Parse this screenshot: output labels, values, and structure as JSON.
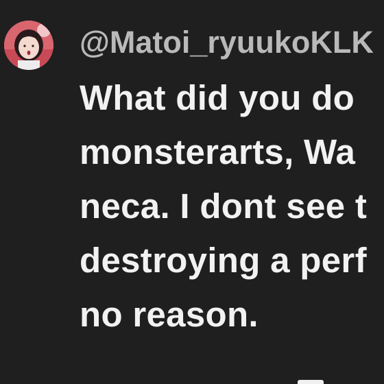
{
  "tweet": {
    "handle": "@Matoi_ryuukoKLK",
    "body_lines": [
      "What did you do",
      "monsterarts, Wa",
      "neca. I dont see t",
      "destroying a perf",
      "no reason."
    ]
  },
  "colors": {
    "background": "#1f1f1f",
    "handle_text": "#b9b9b9",
    "body_text": "#f2f2f2",
    "avatar_bg": "#e07a82"
  }
}
